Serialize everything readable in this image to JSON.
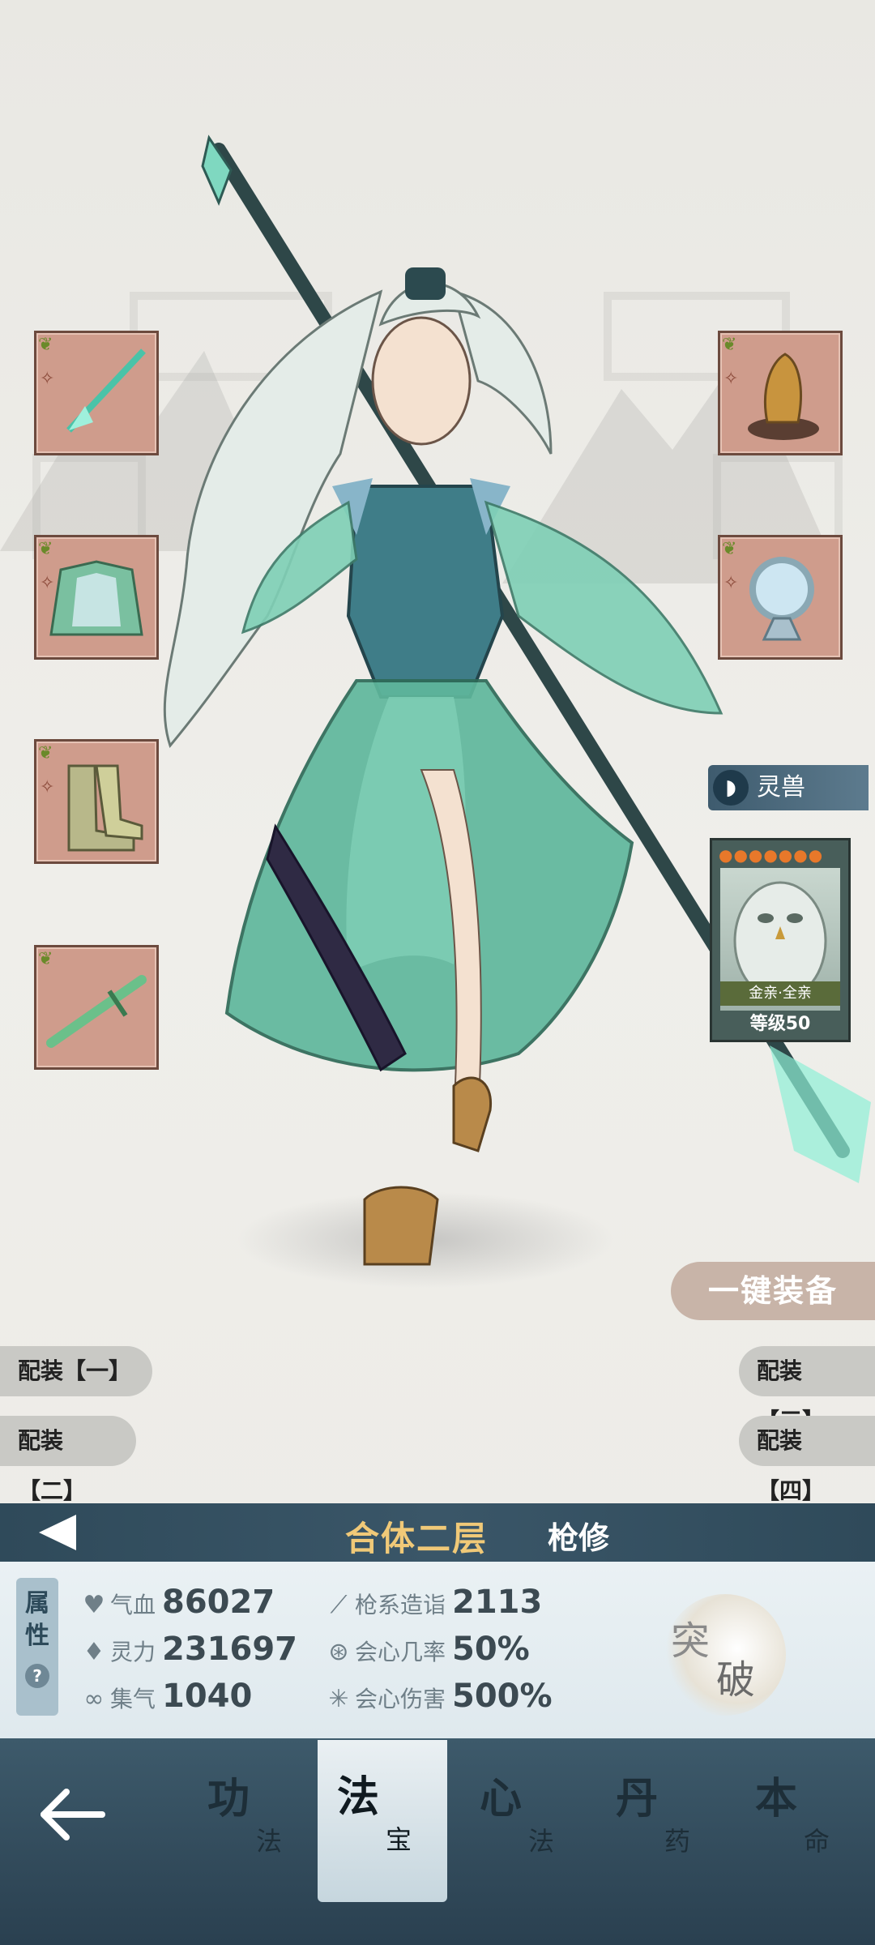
{
  "equipment_left": [
    {
      "name": "spear-slot"
    },
    {
      "name": "robe-slot"
    },
    {
      "name": "boots-slot"
    },
    {
      "name": "sword-slot"
    }
  ],
  "equipment_right": [
    {
      "name": "talisman-slot"
    },
    {
      "name": "mirror-slot"
    }
  ],
  "beast": {
    "tab_label": "灵兽",
    "affinity": "金亲·全亲",
    "level_label": "等级50",
    "stars": "●●●●●●●"
  },
  "loadouts": {
    "one": "配装【一】",
    "two": "配装【二】",
    "three": "配装【三】",
    "four": "配装【四】"
  },
  "one_key_equip": "一键装备",
  "realm": {
    "stage": "合体二层",
    "class": "枪修"
  },
  "attributes_tab": {
    "line1": "属",
    "line2": "性",
    "help": "?"
  },
  "stats": [
    {
      "icon": "heart-icon",
      "name": "气血",
      "value": "86027"
    },
    {
      "icon": "drop-icon",
      "name": "灵力",
      "value": "231697"
    },
    {
      "icon": "swirl-icon",
      "name": "集气",
      "value": "1040"
    },
    {
      "icon": "spear-icon",
      "name": "枪系造诣",
      "value": "2113"
    },
    {
      "icon": "crit-icon",
      "name": "会心几率",
      "value": "50%"
    },
    {
      "icon": "burst-icon",
      "name": "会心伤害",
      "value": "500%"
    }
  ],
  "breakthrough": {
    "c1": "突",
    "c2": "破"
  },
  "nav": [
    {
      "big": "功",
      "small": "法"
    },
    {
      "big": "法",
      "small": "宝"
    },
    {
      "big": "心",
      "small": "法"
    },
    {
      "big": "丹",
      "small": "药"
    },
    {
      "big": "本",
      "small": "命"
    }
  ],
  "colors": {
    "accent_gold": "#f0c978",
    "bar_dark": "#2f4a5a",
    "slot_bg": "#cf9c8c"
  }
}
